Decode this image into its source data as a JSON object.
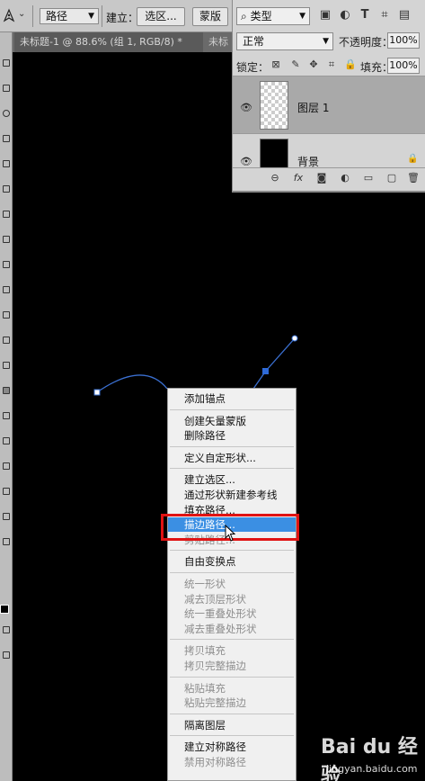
{
  "options_bar": {
    "mode_select": "路径",
    "make_label": "建立：",
    "selection_button": "选区...",
    "mask_button": "蒙版"
  },
  "document_tabs": {
    "active_tab": "未标题-1 @ 88.6% (组 1, RGB/8) *",
    "next_tab": "未标"
  },
  "layers_panel": {
    "filter_kind": "类型",
    "blend_mode": "正常",
    "opacity_label": "不透明度：",
    "opacity_value": "100%",
    "lock_label": "锁定：",
    "fill_label": "填充：",
    "fill_value": "100%",
    "layers": [
      {
        "name": "图层 1",
        "visible": true,
        "selected": true
      },
      {
        "name": "背景",
        "visible": true,
        "selected": false
      }
    ]
  },
  "context_menu": {
    "groups": [
      [
        {
          "label": "添加锚点",
          "enabled": true
        }
      ],
      [
        {
          "label": "创建矢量蒙版",
          "enabled": true
        },
        {
          "label": "删除路径",
          "enabled": true
        }
      ],
      [
        {
          "label": "定义自定形状...",
          "enabled": true
        }
      ],
      [
        {
          "label": "建立选区...",
          "enabled": true
        },
        {
          "label": "通过形状新建参考线",
          "enabled": true
        },
        {
          "label": "填充路径...",
          "enabled": true
        },
        {
          "label": "描边路径...",
          "enabled": true,
          "highlighted": true
        },
        {
          "label": "剪贴路径...",
          "enabled": false
        }
      ],
      [
        {
          "label": "自由变换点",
          "enabled": true
        }
      ],
      [
        {
          "label": "统一形状",
          "enabled": false
        },
        {
          "label": "减去顶层形状",
          "enabled": false
        },
        {
          "label": "统一重叠处形状",
          "enabled": false
        },
        {
          "label": "减去重叠处形状",
          "enabled": false
        }
      ],
      [
        {
          "label": "拷贝填充",
          "enabled": false
        },
        {
          "label": "拷贝完整描边",
          "enabled": false
        }
      ],
      [
        {
          "label": "粘贴填充",
          "enabled": false
        },
        {
          "label": "粘贴完整描边",
          "enabled": false
        }
      ],
      [
        {
          "label": "隔离图层",
          "enabled": true
        }
      ],
      [
        {
          "label": "建立对称路径",
          "enabled": true
        },
        {
          "label": "禁用对称路径",
          "enabled": false
        }
      ]
    ]
  },
  "watermark": {
    "logo": "Bai du 经验",
    "url": "jingyan.baidu.com"
  },
  "colors": {
    "highlight": "#3b8fe3",
    "annotation_box": "#e01313",
    "path_stroke": "#3a6fd0"
  }
}
